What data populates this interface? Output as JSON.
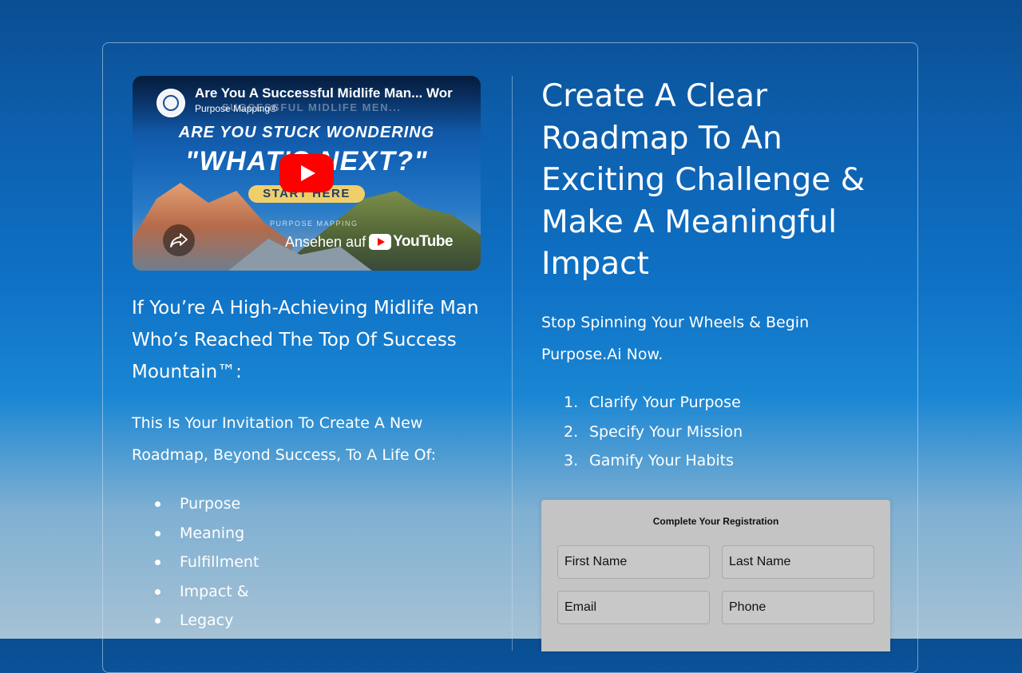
{
  "video": {
    "title": "Are You A Successful Midlife Man... Wor",
    "channel": "Purpose Mapping®",
    "overlay_ghost": "SUCCESSFUL MIDLIFE MEN...",
    "headline_1": "ARE YOU STUCK WONDERING",
    "headline_2": "\"WHAT'S NEXT?\"",
    "start_label": "START HERE",
    "brand": "PURPOSE MAPPING",
    "watch_on": "Ansehen auf",
    "youtube_word": "YouTube"
  },
  "left": {
    "heading": "If You’re A High-Achieving Midlife Man Who’s Reached The Top Of Success Mountain™:",
    "subheading": "This Is Your Invitation To Create A New Roadmap, Beyond Success, To A Life Of:",
    "bullets": [
      "Purpose",
      "Meaning",
      "Fulfillment",
      "Impact &",
      "Legacy"
    ]
  },
  "right": {
    "heading": "Create A Clear Roadmap To An Exciting Challenge & Make A Meaningful Impact",
    "subheading": "Stop Spinning Your Wheels & Begin Purpose.Ai Now.",
    "steps": [
      {
        "num": "1.",
        "label": "Clarify Your Purpose"
      },
      {
        "num": "2.",
        "label": "Specify Your Mission"
      },
      {
        "num": "3.",
        "label": "Gamify Your Habits"
      }
    ]
  },
  "form": {
    "title": "Complete Your Registration",
    "first_name": "First Name",
    "last_name": "Last Name",
    "email": "Email",
    "phone": "Phone"
  }
}
